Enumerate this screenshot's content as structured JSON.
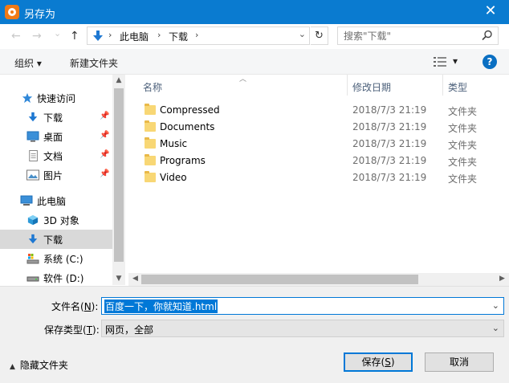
{
  "window": {
    "title": "另存为",
    "close_glyph": "✕"
  },
  "nav": {
    "back": "←",
    "forward": "→",
    "recent": "⌄",
    "up": "↑",
    "refresh": "↻",
    "dropdown": "⌄"
  },
  "address": {
    "crumbs": [
      "此电脑",
      "下载"
    ],
    "separator": "›"
  },
  "search": {
    "placeholder": "搜索\"下载\""
  },
  "toolbar": {
    "organize": "组织 ▾",
    "new_folder": "新建文件夹",
    "view_dropdown": "▾",
    "help": "?"
  },
  "sidebar": {
    "items": [
      {
        "label": "快速访问",
        "icon": "star-icon"
      },
      {
        "label": "下载",
        "icon": "download-icon",
        "pinned": true
      },
      {
        "label": "桌面",
        "icon": "desktop-icon",
        "pinned": true
      },
      {
        "label": "文档",
        "icon": "document-icon",
        "pinned": true
      },
      {
        "label": "图片",
        "icon": "picture-icon",
        "pinned": true
      },
      {
        "label": "此电脑",
        "icon": "pc-icon"
      },
      {
        "label": "3D 对象",
        "icon": "3d-objects-icon"
      },
      {
        "label": "下载",
        "icon": "download-icon",
        "selected": true
      },
      {
        "label": "系统 (C:)",
        "icon": "drive-c-icon"
      },
      {
        "label": "软件 (D:)",
        "icon": "drive-d-icon"
      }
    ],
    "pin_glyph": "📌"
  },
  "columns": {
    "name": "名称",
    "date": "修改日期",
    "type": "类型"
  },
  "files": [
    {
      "name": "Compressed",
      "date": "2018/7/3 21:19",
      "type": "文件夹"
    },
    {
      "name": "Documents",
      "date": "2018/7/3 21:19",
      "type": "文件夹"
    },
    {
      "name": "Music",
      "date": "2018/7/3 21:19",
      "type": "文件夹"
    },
    {
      "name": "Programs",
      "date": "2018/7/3 21:19",
      "type": "文件夹"
    },
    {
      "name": "Video",
      "date": "2018/7/3 21:19",
      "type": "文件夹"
    }
  ],
  "form": {
    "filename_label_pre": "文件名(",
    "filename_label_key": "N",
    "filename_label_post": "):",
    "filename_value": "百度一下，你就知道.html",
    "filetype_label_pre": "保存类型(",
    "filetype_label_key": "T",
    "filetype_label_post": "):",
    "filetype_value": "网页，全部",
    "dropdown": "⌄"
  },
  "footer": {
    "hide_folders": "隐藏文件夹",
    "save_pre": "保存(",
    "save_key": "S",
    "save_post": ")",
    "cancel": "取消"
  },
  "colors": {
    "titlebar": "#0a7bd0",
    "accent": "#0078d7",
    "folder": "#f8d775"
  }
}
